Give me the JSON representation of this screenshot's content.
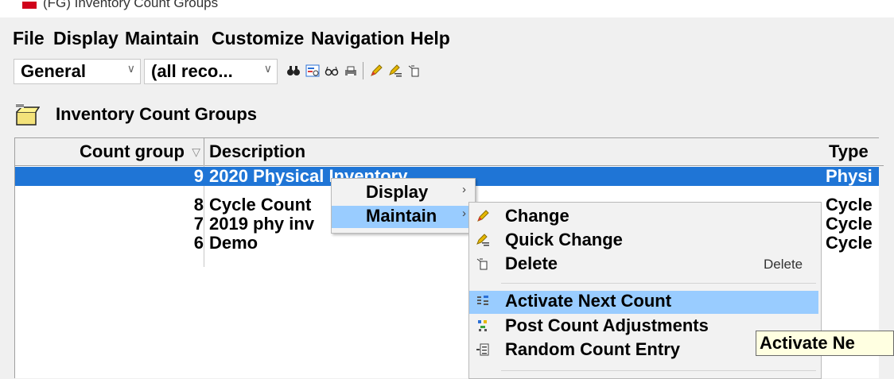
{
  "window": {
    "title": "(FG) Inventory Count Groups"
  },
  "menubar": [
    "File",
    "Display",
    "Maintain",
    "Customize",
    "Navigation",
    "Help"
  ],
  "toolbar": {
    "view_select": "General",
    "filter_select": "(all reco...",
    "icons": [
      "binoculars-icon",
      "filter-icon",
      "glasses-icon",
      "print-icon",
      "pencil-icon",
      "quick-edit-icon",
      "delete-icon"
    ]
  },
  "page": {
    "title": "Inventory Count Groups",
    "icon": "box-icon"
  },
  "table": {
    "columns": [
      "Count group",
      "Description",
      "Type"
    ],
    "sort_icon": "sort-down-icon",
    "rows": [
      {
        "group": "9",
        "description": "2020 Physical Inventory",
        "type": "Physi",
        "selected": true
      },
      {
        "group": "8",
        "description": "Cycle Count",
        "type": "Cycle",
        "selected": false
      },
      {
        "group": "7",
        "description": "2019 phy inv",
        "type": "Cycle",
        "selected": false
      },
      {
        "group": "6",
        "description": "Demo",
        "type": "Cycle",
        "selected": false
      }
    ]
  },
  "context_menu": {
    "items": [
      {
        "label": "Display",
        "submenu": true
      },
      {
        "label": "Maintain",
        "submenu": true,
        "highlighted": true
      }
    ]
  },
  "submenu": {
    "items": [
      {
        "label": "Change",
        "icon": "pencil-icon"
      },
      {
        "label": "Quick Change",
        "icon": "quick-edit-icon"
      },
      {
        "label": "Delete",
        "icon": "delete-icon",
        "shortcut": "Delete"
      },
      {
        "label": "Activate Next Count",
        "icon": "activate-icon",
        "highlighted": true
      },
      {
        "label": "Post Count Adjustments",
        "icon": "post-icon"
      },
      {
        "label": "Random Count Entry",
        "icon": "random-entry-icon"
      }
    ]
  },
  "tooltip": {
    "text": "Activate Ne"
  },
  "colors": {
    "selection": "#1f75d6",
    "menu_highlight": "#99ccff",
    "tooltip_bg": "#ffffe1"
  }
}
